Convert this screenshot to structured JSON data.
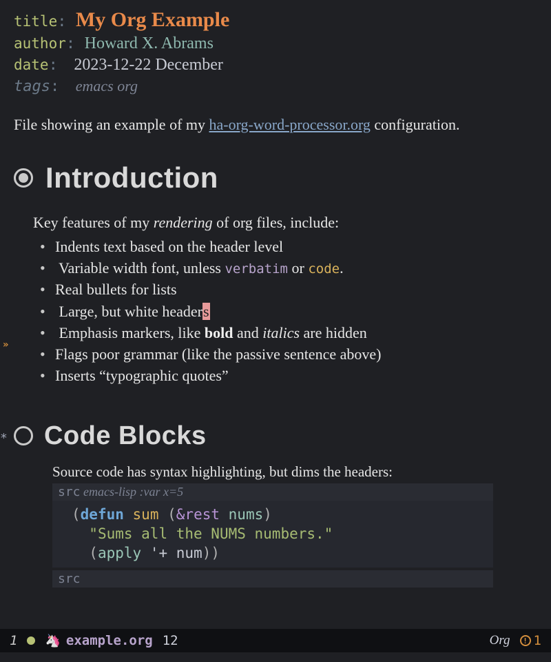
{
  "frontmatter": {
    "title_key": "title",
    "title_val": "My Org Example",
    "author_key": "author",
    "author_val": "Howard X. Abrams",
    "date_key": "date",
    "date_val": "2023-12-22 December",
    "tags_key": "tags",
    "tags_val": "emacs org",
    "sep": ":"
  },
  "intro": {
    "pre": "File showing an example of my ",
    "link": "ha-org-word-processor.org",
    "post": " configuration."
  },
  "h1": {
    "text": "Introduction"
  },
  "features": {
    "lead_pre": "Key features of my ",
    "lead_em": "rendering",
    "lead_post": " of org files, include:",
    "i0": "Indents text based on the header level",
    "i1_pre": "Variable width font, unless ",
    "i1_verbatim": "verbatim",
    "i1_mid": " or ",
    "i1_code": "code",
    "i1_post": ".",
    "i2": "Real bullets for lists",
    "i3_pre": "Large, but white header",
    "i3_cursor": "s",
    "i4_pre": "Emphasis markers, like ",
    "i4_bold": "bold",
    "i4_mid": " and ",
    "i4_ital": "italics ",
    "i4_post": "are hidden",
    "i5": "Flags poor grammar (like the passive sentence above)",
    "i6": "Inserts “typographic quotes”"
  },
  "h2": {
    "star": "*",
    "text": "Code Blocks"
  },
  "codeblock": {
    "intro": "Source code has syntax highlighting, but dims the headers:",
    "src_label": "src",
    "src_lang": " emacs-lisp :var x=5",
    "line1_open": "(",
    "line1_kw": "defun",
    "line1_sp1": " ",
    "line1_fn": "sum",
    "line1_sp2": " ",
    "line1_paren2": "(",
    "line1_rest": "&rest",
    "line1_sp3": " ",
    "line1_arg": "nums",
    "line1_close": ")",
    "line2_str": "\"Sums all the NUMS numbers.\"",
    "line3_open": "(",
    "line3_apply": "apply",
    "line3_mid": " '+ ",
    "line3_num": "num",
    "line3_close": "))",
    "src_end": "src"
  },
  "fringe": {
    "marker": "»"
  },
  "modeline": {
    "winnum": "1",
    "unicorn": "🦄",
    "filename": "example.org",
    "linenum": "12",
    "mode": "Org",
    "warn_icon": "!",
    "warn_count": "1"
  }
}
